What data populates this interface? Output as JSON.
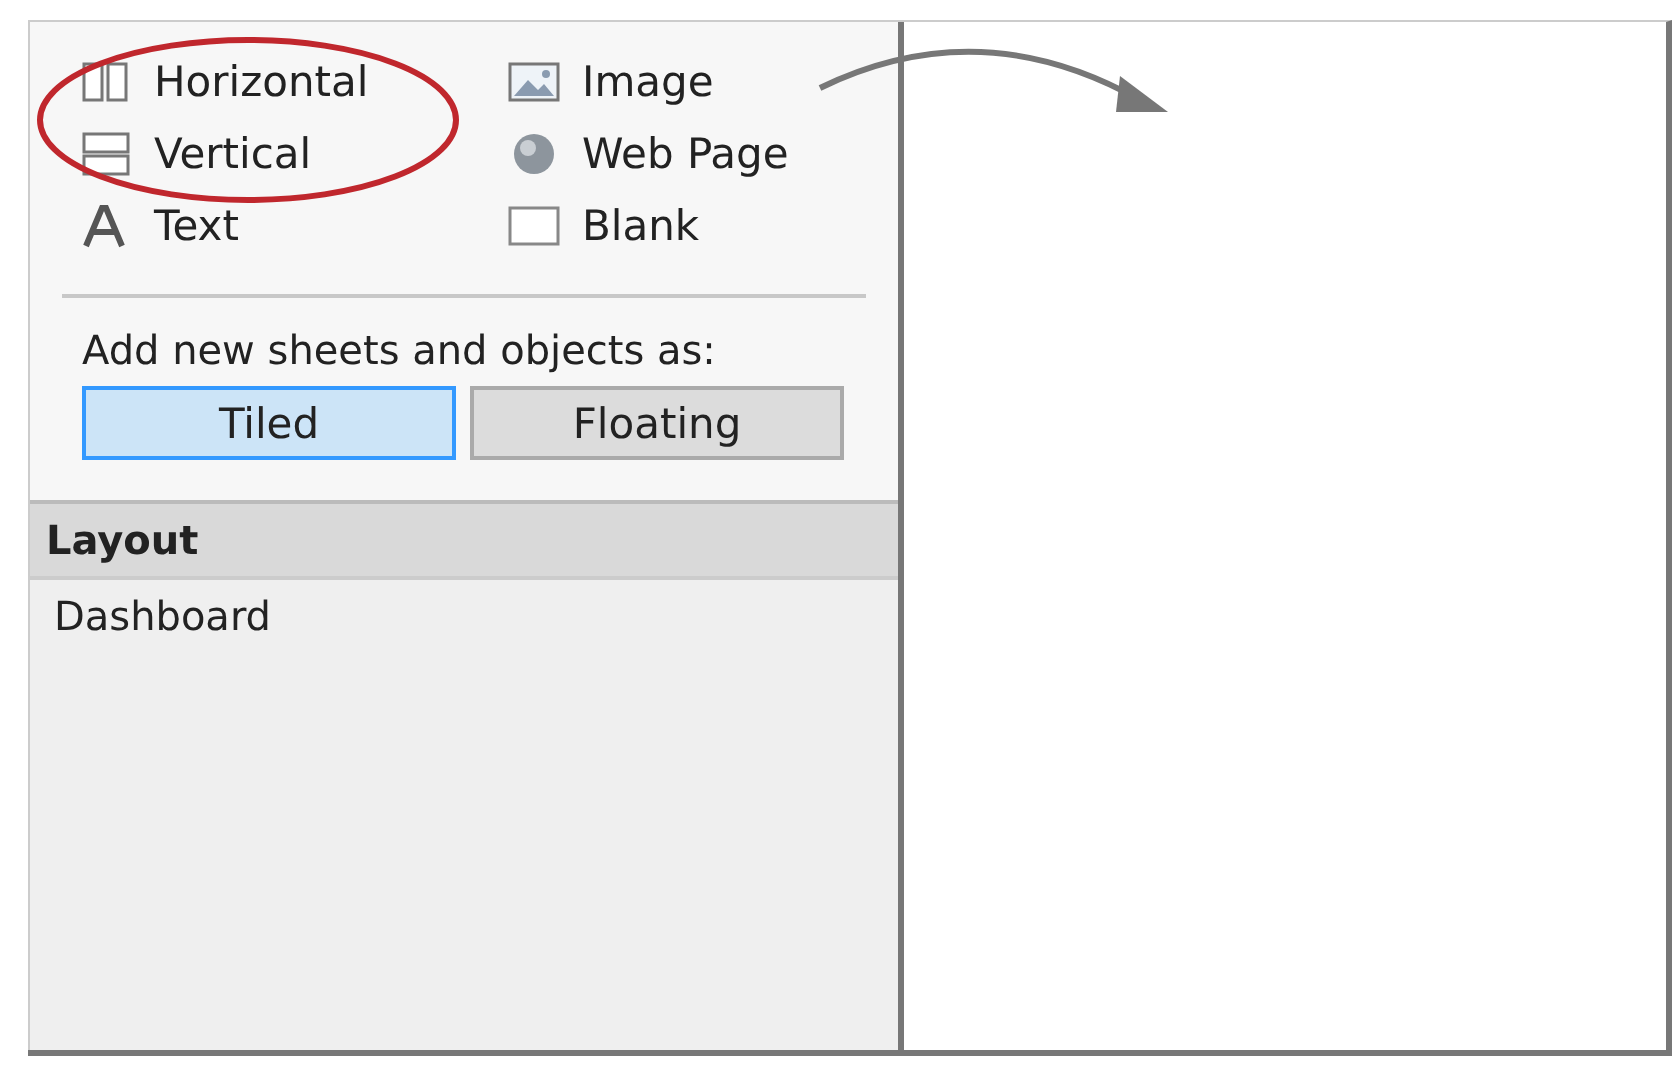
{
  "objects": [
    {
      "label": "Horizontal",
      "kind": "horizontal"
    },
    {
      "label": "Image",
      "kind": "image"
    },
    {
      "label": "Vertical",
      "kind": "vertical"
    },
    {
      "label": "Web Page",
      "kind": "webpage"
    },
    {
      "label": "Text",
      "kind": "text"
    },
    {
      "label": "Blank",
      "kind": "blank"
    }
  ],
  "add_as": {
    "label": "Add new sheets and objects as:",
    "options": [
      {
        "label": "Tiled",
        "selected": true
      },
      {
        "label": "Floating",
        "selected": false
      }
    ]
  },
  "layout": {
    "title": "Layout",
    "items": [
      "Dashboard"
    ]
  }
}
